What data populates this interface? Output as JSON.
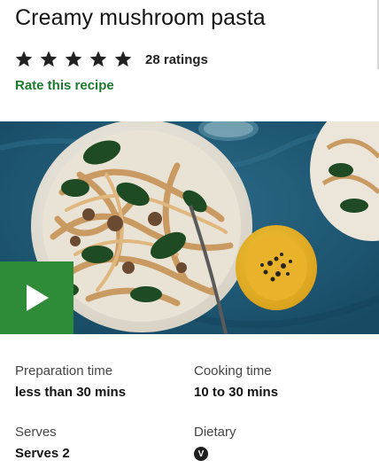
{
  "recipe": {
    "title": "Creamy mushroom pasta",
    "rating": {
      "stars_filled": 5,
      "stars_total": 5,
      "count_label": "28 ratings"
    },
    "rate_link": "Rate this recipe"
  },
  "media": {
    "image_description_icon": "food-photo",
    "play_icon": "play-icon"
  },
  "details": {
    "prep": {
      "label": "Preparation time",
      "value": "less than 30 mins"
    },
    "cook": {
      "label": "Cooking time",
      "value": "10 to 30 mins"
    },
    "serves": {
      "label": "Serves",
      "value": "Serves 2"
    },
    "dietary": {
      "label": "Dietary",
      "badge": "V"
    }
  },
  "colors": {
    "accent_green": "#1a7a2e",
    "play_green": "#2e8b37",
    "star": "#222222"
  }
}
